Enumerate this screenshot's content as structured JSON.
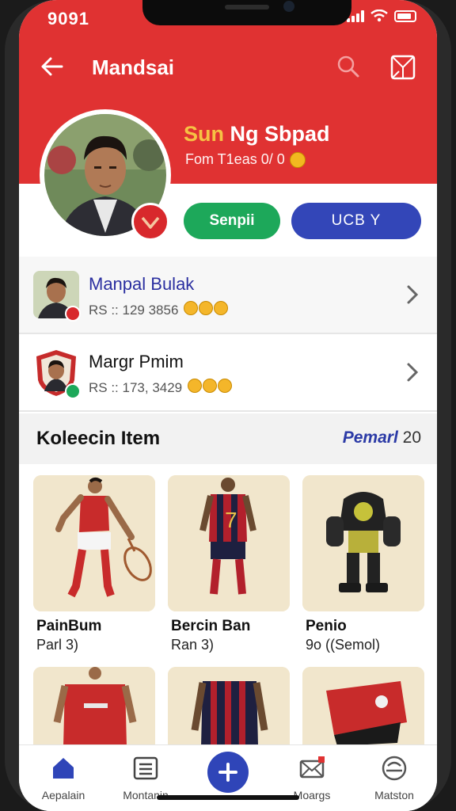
{
  "status_bar": {
    "time": "9091"
  },
  "header": {
    "title": "Mandsai"
  },
  "profile": {
    "name_accent": "Sun",
    "name_rest": " Ng Sbpad",
    "stats": "Fom T1eas 0/ 0",
    "primary_button": "Senpii",
    "secondary_button": "UCB Y"
  },
  "list": [
    {
      "name": "Manpal Bulak",
      "sub": "RS :: 129  3856",
      "name_color": "#2b2fa0"
    },
    {
      "name": "Margr Pmim",
      "sub": "RS :: 173, 3429",
      "name_color": "#111111"
    }
  ],
  "collection": {
    "title": "Koleecin Item",
    "link": "Pemarl",
    "count": "20",
    "items": [
      {
        "name": "PainBum",
        "sub": "Parl 3)"
      },
      {
        "name": "Bercin Ban",
        "sub": "Ran 3)"
      },
      {
        "name": "Penio",
        "sub": "9o ((Semol)"
      }
    ]
  },
  "bottom_nav": [
    {
      "label": "Aepalain",
      "icon": "home-icon"
    },
    {
      "label": "Montanin",
      "icon": "list-icon"
    },
    {
      "label": "",
      "icon": "add-icon"
    },
    {
      "label": "Moargs",
      "icon": "mail-icon"
    },
    {
      "label": "Matston",
      "icon": "profile-icon"
    }
  ],
  "colors": {
    "header_red": "#e03232",
    "accent_yellow": "#f6c244",
    "green_button": "#1da85a",
    "blue_button": "#3346b8",
    "link_blue": "#2b3aa6"
  }
}
